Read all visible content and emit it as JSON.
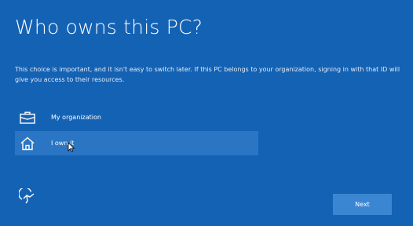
{
  "header": {
    "title": "Who owns this PC?"
  },
  "description": {
    "text": "This choice is important, and it isn't easy to switch later. If this PC belongs to your organization, signing in with that ID will give you access to their resources."
  },
  "options": [
    {
      "label": "My organization",
      "icon": "briefcase-icon"
    },
    {
      "label": "I own it",
      "icon": "home-icon"
    }
  ],
  "footer": {
    "accessibility_icon": "accessibility-icon",
    "next_label": "Next"
  },
  "colors": {
    "background": "#1462b4",
    "selected_option": "#2a76c4",
    "next_button": "#3b86d2",
    "text": "#ffffff"
  }
}
